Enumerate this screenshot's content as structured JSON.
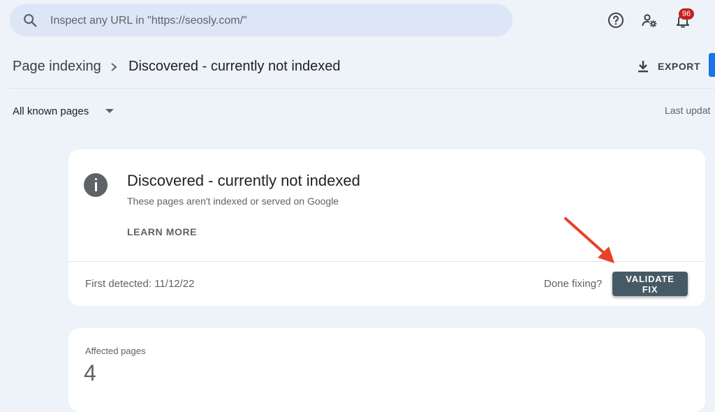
{
  "search": {
    "placeholder": "Inspect any URL in \"https://seosly.com/\"",
    "icon": "search-icon"
  },
  "header_icons": {
    "help": "help-icon",
    "users_settings": "manage-users-icon",
    "notifications": "bell-icon",
    "notification_count": "96"
  },
  "breadcrumb": {
    "root": "Page indexing",
    "current": "Discovered - currently not indexed"
  },
  "toolbar": {
    "export_label": "EXPORT"
  },
  "filter": {
    "selected": "All known pages"
  },
  "last_updated": "Last updat",
  "issue_card": {
    "title": "Discovered - currently not indexed",
    "description": "These pages aren't indexed or served on Google",
    "learn_more": "LEARN MORE",
    "first_detected": "First detected: 11/12/22",
    "done_fixing": "Done fixing?",
    "validate_label": "VALIDATE FIX"
  },
  "affected": {
    "label": "Affected pages",
    "value": "4"
  },
  "colors": {
    "background": "#eef2f9",
    "search_bg": "#dde6f6",
    "validate_button": "#455a64",
    "badge": "#c5221f",
    "accent": "#1a73e8",
    "arrow": "#e8402a"
  }
}
